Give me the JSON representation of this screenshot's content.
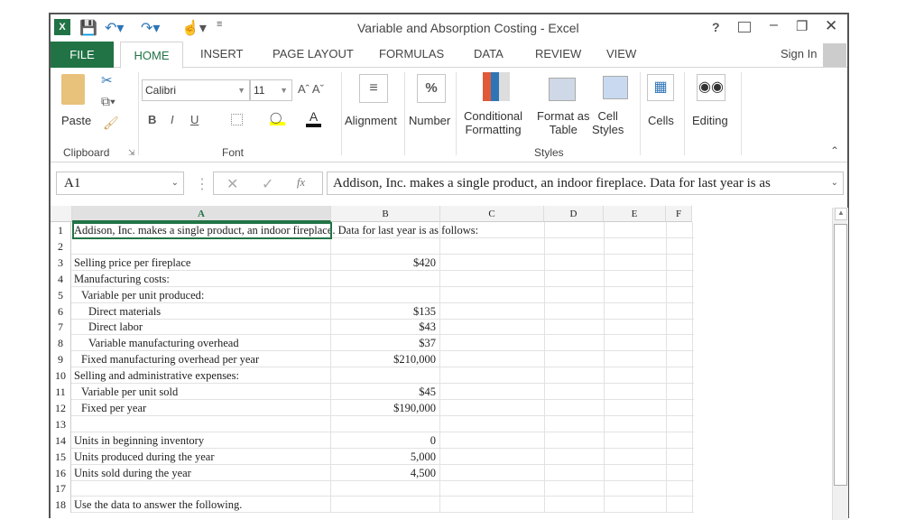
{
  "window": {
    "title": "Variable and Absorption Costing - Excel",
    "help": "?",
    "sign_in": "Sign In"
  },
  "tabs": [
    "FILE",
    "HOME",
    "INSERT",
    "PAGE LAYOUT",
    "FORMULAS",
    "DATA",
    "REVIEW",
    "VIEW"
  ],
  "ribbon": {
    "clipboard": {
      "paste": "Paste",
      "group": "Clipboard"
    },
    "font": {
      "name": "Calibri",
      "size": "11",
      "bold": "B",
      "italic": "I",
      "underline": "U",
      "color_a": "A",
      "group": "Font"
    },
    "alignment": "Alignment",
    "number": "Number",
    "percent": "%",
    "conditional": [
      "Conditional",
      "Formatting"
    ],
    "format_table": [
      "Format as",
      "Table"
    ],
    "cell_styles": [
      "Cell",
      "Styles"
    ],
    "styles_group": "Styles",
    "cells": "Cells",
    "editing": "Editing"
  },
  "formula_bar": {
    "name_box": "A1",
    "fx": "fx",
    "content": "Addison, Inc. makes a single product, an indoor fireplace. Data for last year is as"
  },
  "columns": [
    "A",
    "B",
    "C",
    "D",
    "E",
    "F"
  ],
  "rows": [
    {
      "n": "1",
      "a": "Addison, Inc. makes a single product, an indoor fireplace. Data for last year is as follows:",
      "b": "",
      "indent": 0
    },
    {
      "n": "2",
      "a": "",
      "b": "",
      "indent": 0
    },
    {
      "n": "3",
      "a": "Selling price per fireplace",
      "b": "$420",
      "indent": 0
    },
    {
      "n": "4",
      "a": "Manufacturing costs:",
      "b": "",
      "indent": 0
    },
    {
      "n": "5",
      "a": "Variable per unit produced:",
      "b": "",
      "indent": 1
    },
    {
      "n": "6",
      "a": "Direct materials",
      "b": "$135",
      "indent": 2
    },
    {
      "n": "7",
      "a": "Direct labor",
      "b": "$43",
      "indent": 2
    },
    {
      "n": "8",
      "a": "Variable manufacturing overhead",
      "b": "$37",
      "indent": 2
    },
    {
      "n": "9",
      "a": "Fixed manufacturing overhead per year",
      "b": "$210,000",
      "indent": 1
    },
    {
      "n": "10",
      "a": "Selling and administrative expenses:",
      "b": "",
      "indent": 0
    },
    {
      "n": "11",
      "a": "Variable per unit sold",
      "b": "$45",
      "indent": 1
    },
    {
      "n": "12",
      "a": "Fixed per year",
      "b": "$190,000",
      "indent": 1
    },
    {
      "n": "13",
      "a": "",
      "b": "",
      "indent": 0
    },
    {
      "n": "14",
      "a": "Units in beginning inventory",
      "b": "0",
      "indent": 0
    },
    {
      "n": "15",
      "a": "Units produced during the year",
      "b": "5,000",
      "indent": 0
    },
    {
      "n": "16",
      "a": "Units sold during the year",
      "b": "4,500",
      "indent": 0
    },
    {
      "n": "17",
      "a": "",
      "b": "",
      "indent": 0
    },
    {
      "n": "18",
      "a": "Use the data to answer the following.",
      "b": "",
      "indent": 0
    }
  ],
  "colors": {
    "accent": "#217346"
  }
}
